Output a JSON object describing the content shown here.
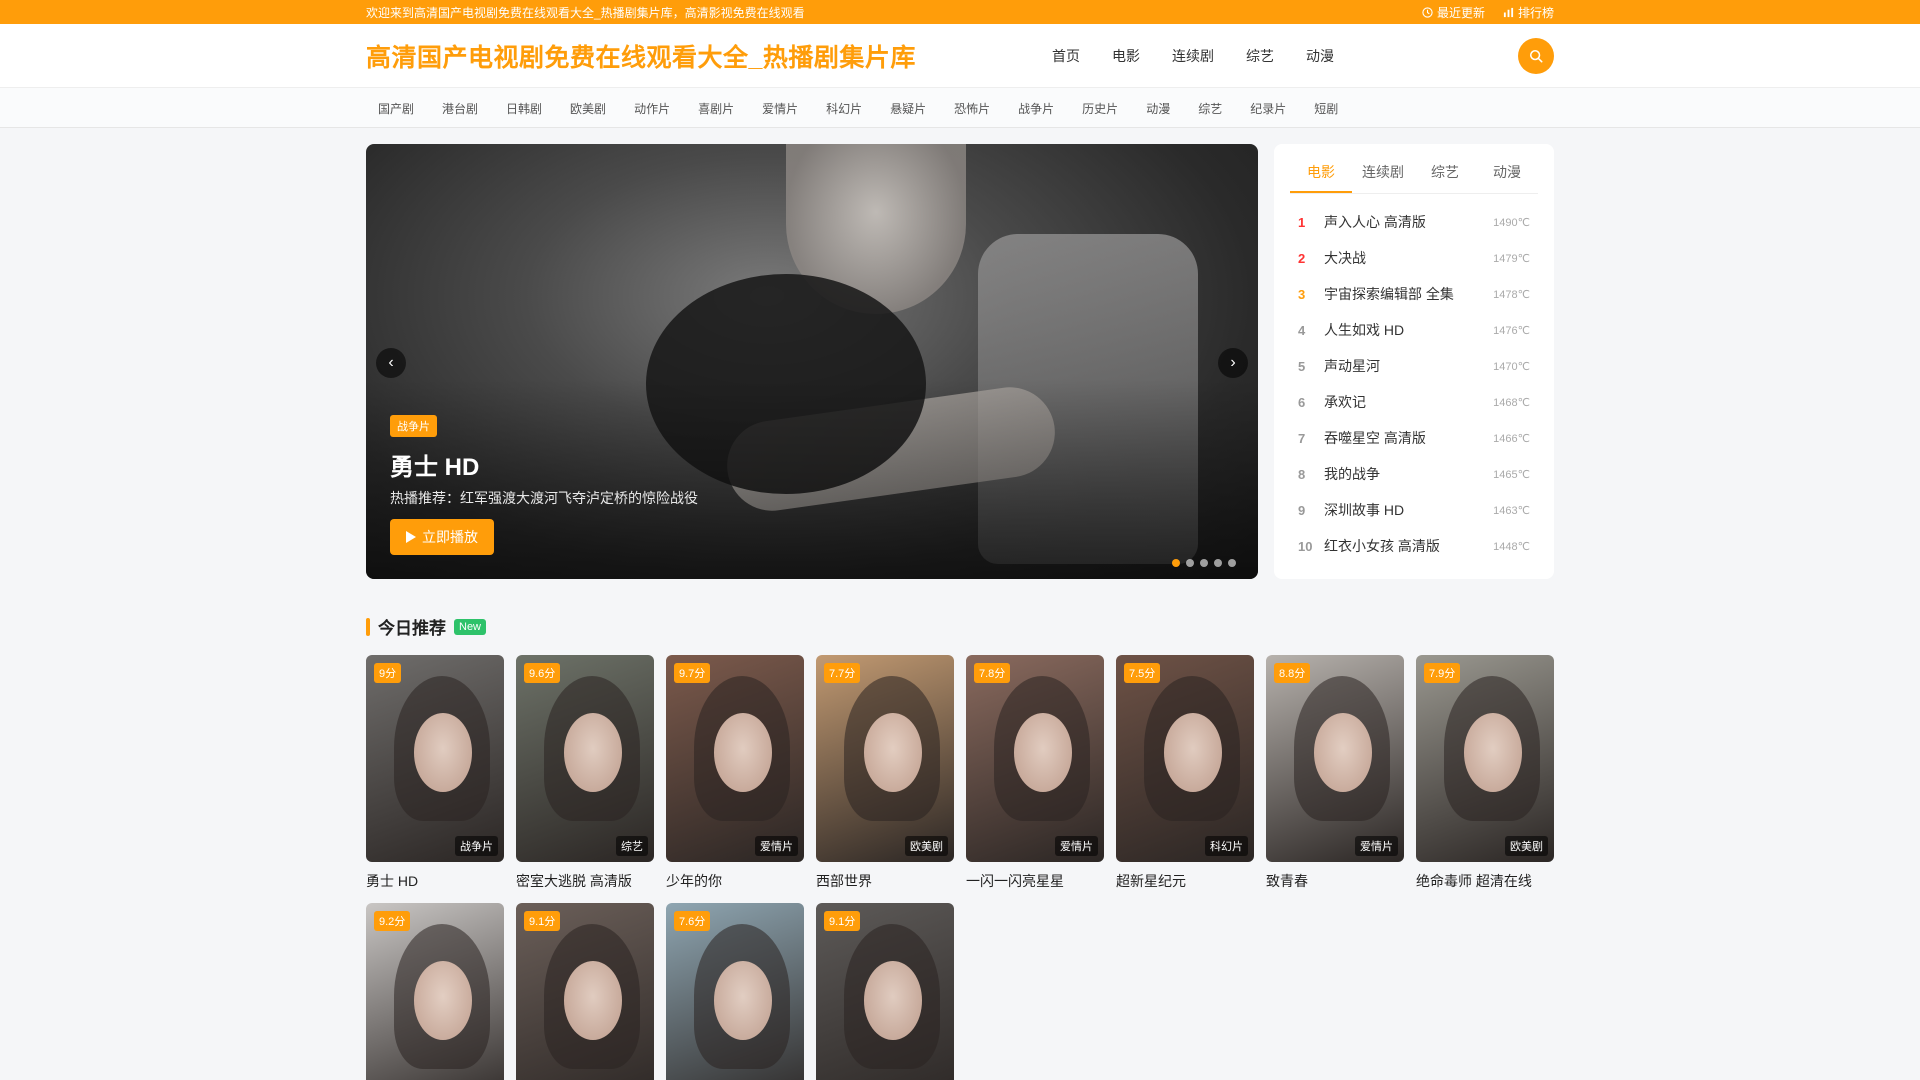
{
  "topbar": {
    "welcome": "欢迎来到高清国产电视剧免费在线观看大全_热播剧集片库，高清影视免费在线观看",
    "recent": "最近更新",
    "ranking": "排行榜"
  },
  "header": {
    "logo": "高清国产电视剧免费在线观看大全_热播剧集片库",
    "nav": [
      "首页",
      "电影",
      "连续剧",
      "综艺",
      "动漫"
    ]
  },
  "subnav": [
    "国产剧",
    "港台剧",
    "日韩剧",
    "欧美剧",
    "动作片",
    "喜剧片",
    "爱情片",
    "科幻片",
    "悬疑片",
    "恐怖片",
    "战争片",
    "历史片",
    "动漫",
    "综艺",
    "纪录片",
    "短剧"
  ],
  "banner": {
    "tag": "战争片",
    "title": "勇士 HD",
    "desc": "热播推荐：红军强渡大渡河飞夺泸定桥的惊险战役",
    "play": "立即播放",
    "dots": 5,
    "active_dot": 0
  },
  "rank": {
    "tabs": [
      "电影",
      "连续剧",
      "综艺",
      "动漫"
    ],
    "active_tab": 0,
    "items": [
      {
        "no": "1",
        "name": "声入人心 高清版",
        "hot": "1490℃"
      },
      {
        "no": "2",
        "name": "大决战",
        "hot": "1479℃"
      },
      {
        "no": "3",
        "name": "宇宙探索编辑部 全集",
        "hot": "1478℃"
      },
      {
        "no": "4",
        "name": "人生如戏 HD",
        "hot": "1476℃"
      },
      {
        "no": "5",
        "name": "声动星河",
        "hot": "1470℃"
      },
      {
        "no": "6",
        "name": "承欢记",
        "hot": "1468℃"
      },
      {
        "no": "7",
        "name": "吞噬星空 高清版",
        "hot": "1466℃"
      },
      {
        "no": "8",
        "name": "我的战争",
        "hot": "1465℃"
      },
      {
        "no": "9",
        "name": "深圳故事 HD",
        "hot": "1463℃"
      },
      {
        "no": "10",
        "name": "红衣小女孩 高清版",
        "hot": "1448℃"
      }
    ]
  },
  "recommend": {
    "title": "今日推荐",
    "badge": "New",
    "cards": [
      {
        "score": "9分",
        "cat": "战争片",
        "title": "勇士 HD",
        "bg": "#6f6d6b"
      },
      {
        "score": "9.6分",
        "cat": "综艺",
        "title": "密室大逃脱 高清版",
        "bg": "#6d7268"
      },
      {
        "score": "9.7分",
        "cat": "爱情片",
        "title": "少年的你",
        "bg": "#7c5a4c"
      },
      {
        "score": "7.7分",
        "cat": "欧美剧",
        "title": "西部世界",
        "bg": "#c29a72"
      },
      {
        "score": "7.8分",
        "cat": "爱情片",
        "title": "一闪一闪亮星星",
        "bg": "#8a6a5e"
      },
      {
        "score": "7.5分",
        "cat": "科幻片",
        "title": "超新星纪元",
        "bg": "#6e5246"
      },
      {
        "score": "8.8分",
        "cat": "爱情片",
        "title": "致青春",
        "bg": "#b7b2ad"
      },
      {
        "score": "7.9分",
        "cat": "欧美剧",
        "title": "绝命毒师 超清在线",
        "bg": "#9a9890"
      },
      {
        "score": "9.2分",
        "cat": "",
        "title": "",
        "bg": "#c9c6c4"
      },
      {
        "score": "9.1分",
        "cat": "",
        "title": "",
        "bg": "#6b5f59"
      },
      {
        "score": "7.6分",
        "cat": "",
        "title": "",
        "bg": "#8fa6b2"
      },
      {
        "score": "9.1分",
        "cat": "",
        "title": "",
        "bg": "#5d5a58"
      }
    ]
  },
  "colors": {
    "accent": "#ff9d0a",
    "new_badge": "#2ec26a",
    "rank_hot": "#ff3333"
  }
}
